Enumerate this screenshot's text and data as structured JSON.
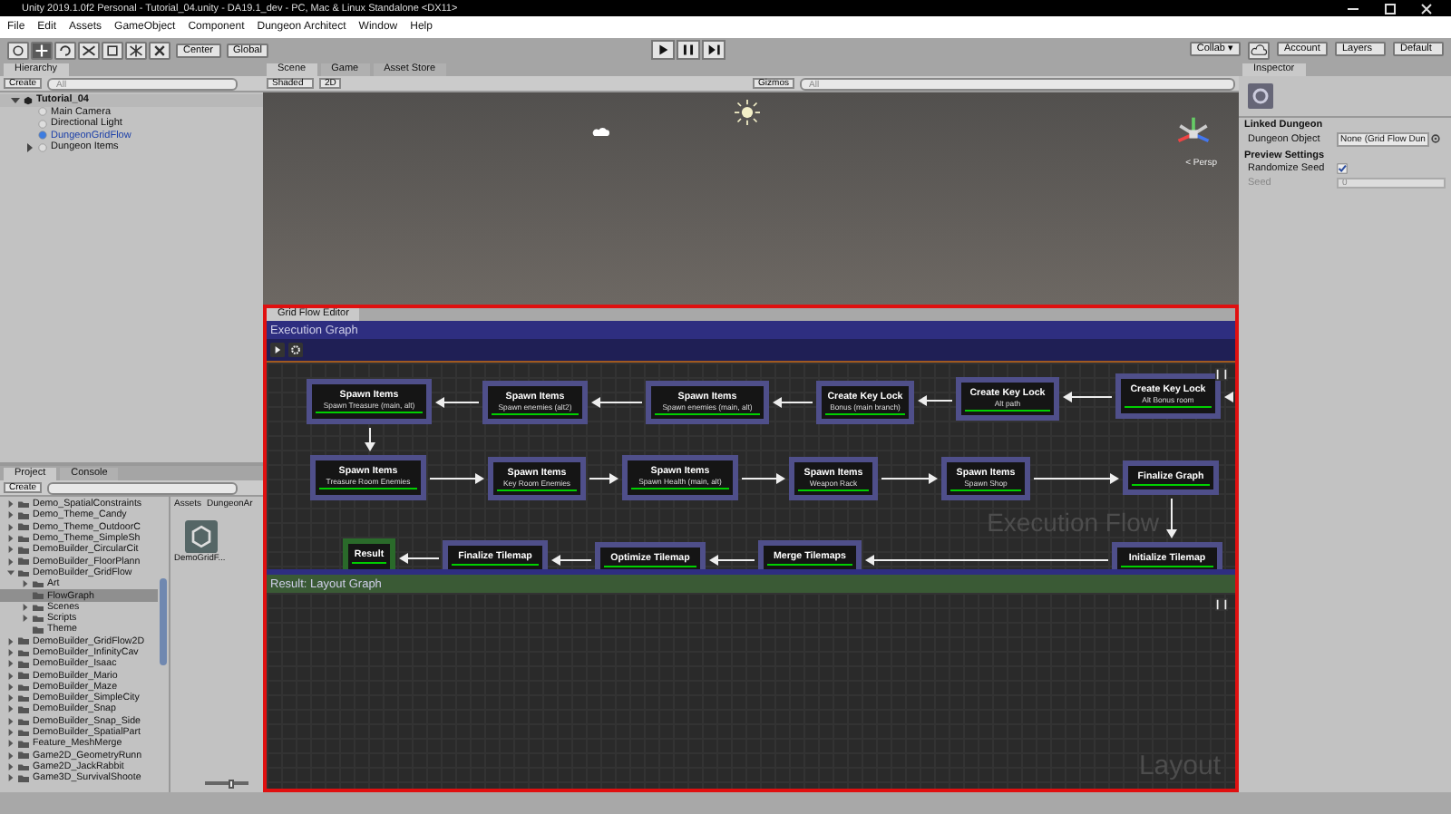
{
  "window": {
    "title": "Unity 2019.1.0f2 Personal - Tutorial_04.unity - DA19.1_dev - PC, Mac & Linux Standalone <DX11>"
  },
  "menu": [
    "File",
    "Edit",
    "Assets",
    "GameObject",
    "Component",
    "Dungeon Architect",
    "Window",
    "Help"
  ],
  "toolbar": {
    "pivot": "Center",
    "space": "Global",
    "collab": "Collab ▾",
    "account": "Account",
    "layers": "Layers",
    "layout": "Default"
  },
  "hierarchy": {
    "tab": "Hierarchy",
    "create": "Create",
    "search_placeholder": "All",
    "tree": [
      {
        "label": "Tutorial_04",
        "kind": "scene",
        "expanded": true,
        "children": [
          {
            "label": "Main Camera",
            "kind": "object"
          },
          {
            "label": "Directional Light",
            "kind": "object"
          },
          {
            "label": "DungeonGridFlow",
            "kind": "prefab"
          },
          {
            "label": "Dungeon Items",
            "kind": "object",
            "expanded": false
          }
        ]
      }
    ]
  },
  "project": {
    "tab": "Project",
    "console_tab": "Console",
    "create": "Create",
    "breadcrumb": [
      "Assets",
      "DungeonAr"
    ],
    "asset": "DemoGridF...",
    "zoom_slider": {
      "level": 0.6
    },
    "tree": [
      {
        "label": "Demo_SpatialConstraints",
        "expanded": false,
        "selected": false
      },
      {
        "label": "Demo_Theme_Candy",
        "expanded": false,
        "selected": false
      },
      {
        "label": "Demo_Theme_OutdoorC",
        "expanded": false,
        "selected": false
      },
      {
        "label": "Demo_Theme_SimpleSh",
        "expanded": false,
        "selected": false
      },
      {
        "label": "DemoBuilder_CircularCit",
        "expanded": false,
        "selected": false
      },
      {
        "label": "DemoBuilder_FloorPlann",
        "expanded": false,
        "selected": false
      },
      {
        "label": "DemoBuilder_GridFlow",
        "expanded": true,
        "selected": false,
        "children": [
          {
            "label": "Art",
            "expanded": false,
            "selected": false
          },
          {
            "label": "FlowGraph",
            "selected": true
          },
          {
            "label": "Scenes",
            "expanded": false,
            "selected": false
          },
          {
            "label": "Scripts",
            "expanded": false,
            "selected": false
          },
          {
            "label": "Theme",
            "selected": false
          }
        ]
      },
      {
        "label": "DemoBuilder_GridFlow2D",
        "expanded": false,
        "selected": false
      },
      {
        "label": "DemoBuilder_InfinityCav",
        "expanded": false,
        "selected": false
      },
      {
        "label": "DemoBuilder_Isaac",
        "expanded": false,
        "selected": false
      },
      {
        "label": "DemoBuilder_Mario",
        "expanded": false,
        "selected": false
      },
      {
        "label": "DemoBuilder_Maze",
        "expanded": false,
        "selected": false
      },
      {
        "label": "DemoBuilder_SimpleCity",
        "expanded": false,
        "selected": false
      },
      {
        "label": "DemoBuilder_Snap",
        "expanded": false,
        "selected": false
      },
      {
        "label": "DemoBuilder_Snap_Side",
        "expanded": false,
        "selected": false
      },
      {
        "label": "DemoBuilder_SpatialPart",
        "expanded": false,
        "selected": false
      },
      {
        "label": "Feature_MeshMerge",
        "expanded": false,
        "selected": false
      },
      {
        "label": "Game2D_GeometryRunn",
        "expanded": false,
        "selected": false
      },
      {
        "label": "Game2D_JackRabbit",
        "expanded": false,
        "selected": false
      },
      {
        "label": "Game3D_SurvivalShoote",
        "expanded": false,
        "selected": false
      }
    ]
  },
  "scene": {
    "tabs": [
      {
        "label": "Scene",
        "selected": true
      },
      {
        "label": "Game",
        "selected": false
      },
      {
        "label": "Asset Store",
        "selected": false
      }
    ],
    "shading": "Shaded",
    "mode_2d": "2D",
    "gizmos": "Gizmos",
    "search_placeholder": "All",
    "projection": "< Persp"
  },
  "grid_flow_editor": {
    "tab": "Grid Flow Editor",
    "execution_header": "Execution Graph",
    "execution_watermark": "Execution Flow",
    "nodes": [
      {
        "title": "Spawn Items",
        "subtitle": "Spawn Treasure (main, alt)",
        "kind": "task"
      },
      {
        "title": "Spawn Items",
        "subtitle": "Spawn enemies (alt2)",
        "kind": "task"
      },
      {
        "title": "Spawn Items",
        "subtitle": "Spawn enemies (main, alt)",
        "kind": "task"
      },
      {
        "title": "Create Key Lock",
        "subtitle": "Bonus (main branch)",
        "kind": "task"
      },
      {
        "title": "Create Key Lock",
        "subtitle": "Alt path",
        "kind": "task"
      },
      {
        "title": "Create Key Lock",
        "subtitle": "Alt Bonus room",
        "kind": "task"
      },
      {
        "title": "Spawn Items",
        "subtitle": "Treasure Room Enemies",
        "kind": "task"
      },
      {
        "title": "Spawn Items",
        "subtitle": "Key Room Enemies",
        "kind": "task"
      },
      {
        "title": "Spawn Items",
        "subtitle": "Spawn Health (main, alt)",
        "kind": "task"
      },
      {
        "title": "Spawn Items",
        "subtitle": "Weapon Rack",
        "kind": "task"
      },
      {
        "title": "Spawn Items",
        "subtitle": "Spawn Shop",
        "kind": "task"
      },
      {
        "title": "Finalize Graph",
        "kind": "task"
      },
      {
        "title": "Result",
        "kind": "result"
      },
      {
        "title": "Finalize Tilemap",
        "kind": "task"
      },
      {
        "title": "Optimize Tilemap",
        "kind": "task"
      },
      {
        "title": "Merge Tilemaps",
        "kind": "task"
      },
      {
        "title": "Initialize Tilemap",
        "kind": "task"
      }
    ],
    "result_header": "Result: Layout Graph",
    "result_watermark": "Layout"
  },
  "inspector": {
    "tab": "Inspector",
    "sections": [
      {
        "title": "Linked Dungeon",
        "fields": [
          {
            "label": "Dungeon Object",
            "kind": "object",
            "value": "None (Grid Flow Dun",
            "disabled": false
          }
        ]
      },
      {
        "title": "Preview Settings",
        "fields": [
          {
            "label": "Randomize Seed",
            "kind": "checkbox",
            "checked": true,
            "disabled": false
          },
          {
            "label": "Seed",
            "kind": "int",
            "value": "0",
            "disabled": true
          }
        ]
      }
    ]
  }
}
